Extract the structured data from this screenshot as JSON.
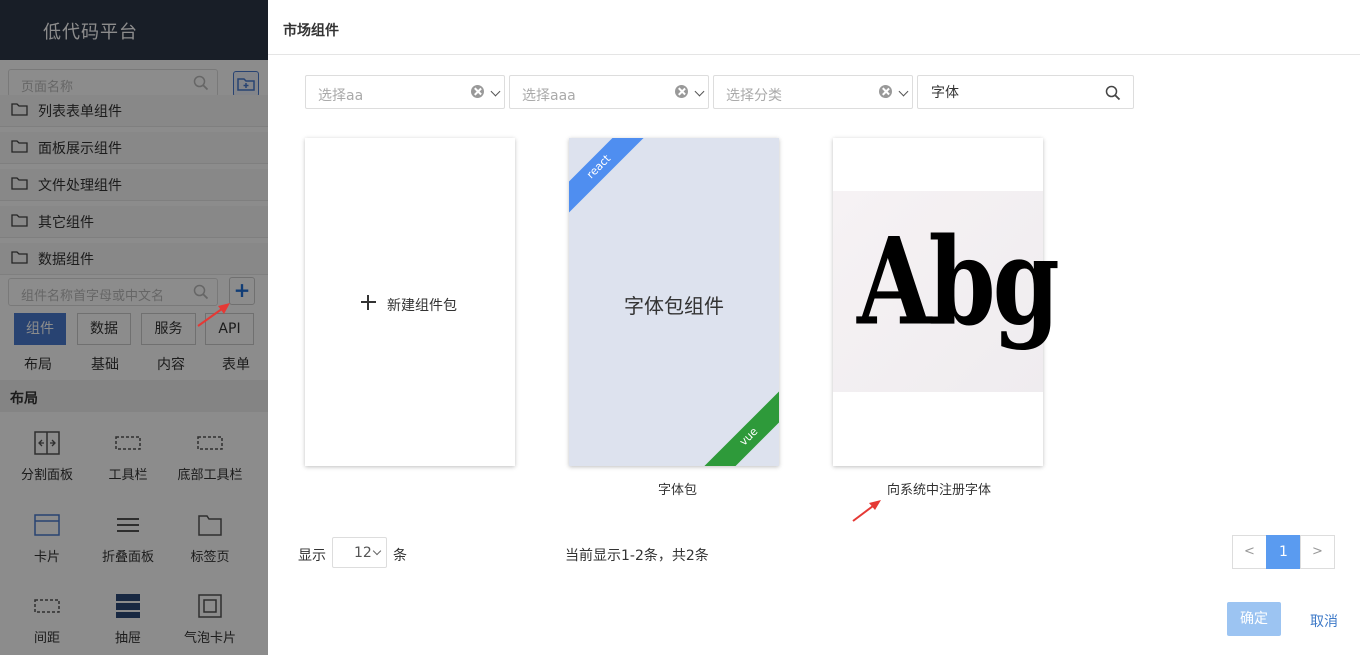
{
  "app": {
    "title": "低代码平台"
  },
  "sidebar": {
    "page_search_placeholder": "页面名称",
    "folders": [
      "列表表单组件",
      "面板展示组件",
      "文件处理组件",
      "其它组件",
      "数据组件"
    ],
    "component_search_placeholder": "组件名称首字母或中文名",
    "add_button": "+",
    "tabs": [
      "组件",
      "数据",
      "服务",
      "API"
    ],
    "active_tab": "组件",
    "subtabs": [
      "布局",
      "基础",
      "内容",
      "表单"
    ],
    "section_title": "布局",
    "widgets": [
      {
        "label": "分割面板",
        "icon": "split-panel-icon"
      },
      {
        "label": "工具栏",
        "icon": "toolbar-icon"
      },
      {
        "label": "底部工具栏",
        "icon": "bottom-toolbar-icon"
      },
      {
        "label": "卡片",
        "icon": "card-icon"
      },
      {
        "label": "折叠面板",
        "icon": "collapse-icon"
      },
      {
        "label": "标签页",
        "icon": "folder-tab-icon"
      },
      {
        "label": "间距",
        "icon": "spacing-icon"
      },
      {
        "label": "抽屉",
        "icon": "drawer-icon"
      },
      {
        "label": "气泡卡片",
        "icon": "popover-card-icon"
      }
    ]
  },
  "dialog": {
    "title": "市场组件",
    "filters": [
      {
        "placeholder": "选择aa"
      },
      {
        "placeholder": "选择aaa"
      },
      {
        "placeholder": "选择分类"
      }
    ],
    "search_value": "字体",
    "cards": {
      "new_label": "新建组件包",
      "font_pack": {
        "title": "字体包组件",
        "caption": "字体包",
        "ribbon_top": "react",
        "ribbon_bottom": "vue"
      },
      "register_font": {
        "image_text": "Abg",
        "caption": "向系统中注册字体"
      }
    },
    "pagination": {
      "show_label": "显示",
      "page_size": "12",
      "unit_label": "条",
      "info": "当前显示1-2条，共2条",
      "prev": "<",
      "current": "1",
      "next": ">"
    },
    "footer": {
      "ok": "确定",
      "cancel": "取消"
    }
  },
  "colors": {
    "primary": "#4a7bd0",
    "topbar": "#2d3748",
    "ribbon_react": "#4f8ef0",
    "ribbon_vue": "#2e9a3a",
    "annotation_arrow": "#e53935"
  }
}
